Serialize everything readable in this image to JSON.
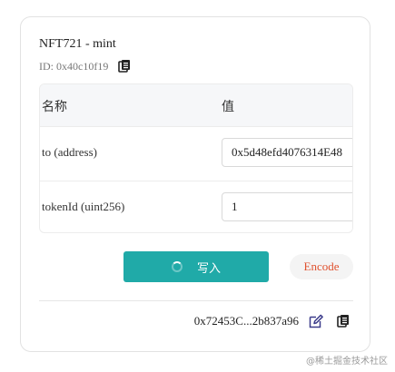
{
  "header": {
    "title": "NFT721 - mint",
    "id_text": "ID: 0x40c10f19"
  },
  "table": {
    "col_name": "名称",
    "col_value": "值",
    "rows": [
      {
        "label": "to (address)",
        "value": "0x5d48efd4076314E48"
      },
      {
        "label": "tokenId (uint256)",
        "value": "1"
      }
    ]
  },
  "actions": {
    "write_label": "写入",
    "encode_label": "Encode"
  },
  "footer": {
    "address": "0x72453C...2b837a96"
  },
  "watermark": "@稀土掘金技术社区",
  "icons": {
    "copy": "copy-icon",
    "edit": "edit-icon",
    "spinner": "loading-spinner-icon"
  },
  "colors": {
    "primary": "#20aaa8",
    "encode_text": "#e0522f",
    "edit_icon": "#3b3b8a"
  }
}
